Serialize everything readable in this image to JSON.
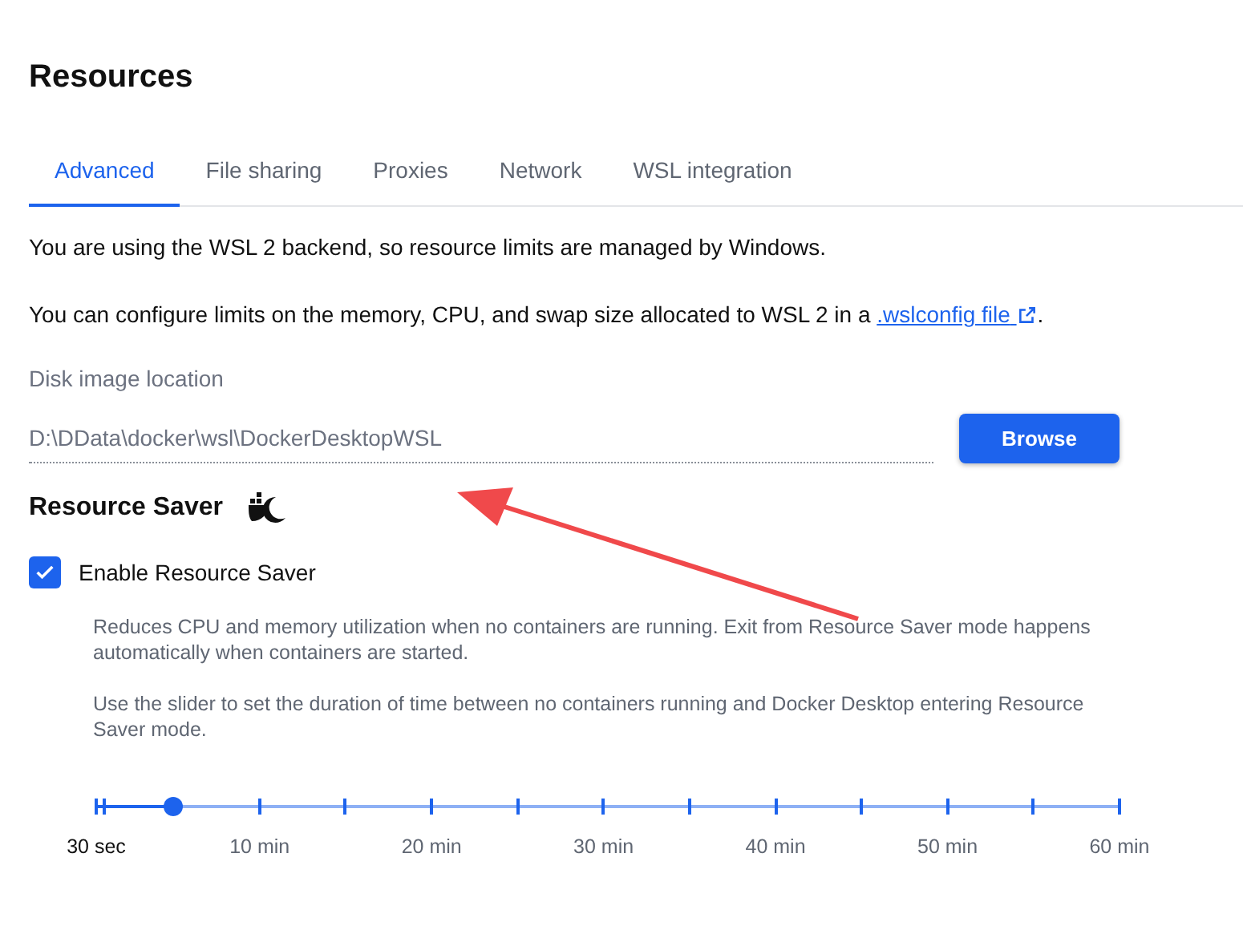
{
  "title": "Resources",
  "tabs": [
    {
      "label": "Advanced",
      "selected": true
    },
    {
      "label": "File sharing",
      "selected": false
    },
    {
      "label": "Proxies",
      "selected": false
    },
    {
      "label": "Network",
      "selected": false
    },
    {
      "label": "WSL integration",
      "selected": false
    }
  ],
  "info": "You are using the WSL 2 backend, so resource limits are managed by Windows.",
  "config_text": "You can configure limits on the memory, CPU, and swap size allocated to WSL 2 in a",
  "config_link": ".wslconfig file",
  "config_end": ".",
  "disk_image": {
    "label": "Disk image location",
    "value": "D:\\DData\\docker\\wsl\\DockerDesktopWSL",
    "button": "Browse"
  },
  "resource_saver": {
    "heading": "Resource Saver",
    "checkbox_label": "Enable Resource Saver",
    "checked": true,
    "description": "Reduces CPU and memory utilization when no containers are running. Exit from Resource Saver mode happens automatically when containers are started.",
    "slider_hint": "Use the slider to set the duration of time between no containers running and Docker Desktop entering Resource Saver mode.",
    "slider": {
      "level": 0.0756,
      "labels": [
        {
          "text": "30 sec",
          "active": true
        },
        {
          "text": "10 min",
          "active": false
        },
        {
          "text": "20 min",
          "active": false
        },
        {
          "text": "30 min",
          "active": false
        },
        {
          "text": "40 min",
          "active": false
        },
        {
          "text": "50 min",
          "active": false
        },
        {
          "text": "60 min",
          "active": false
        }
      ]
    }
  }
}
